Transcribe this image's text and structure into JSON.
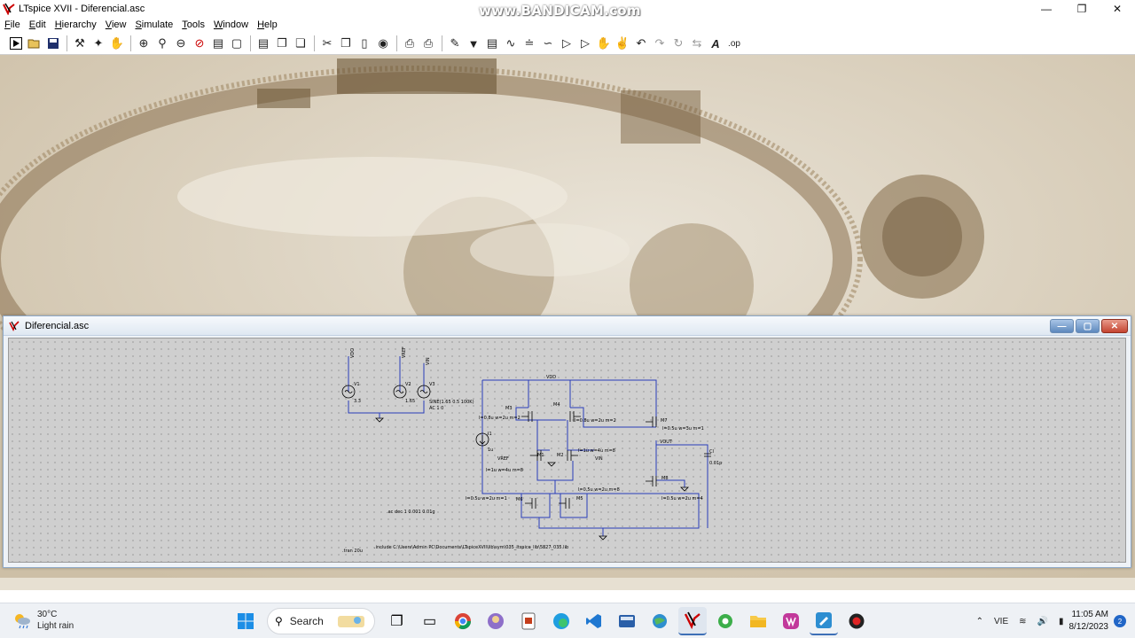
{
  "app": {
    "title": "LTspice XVII - Diferencial.asc",
    "watermark": "www.BANDICAM.com"
  },
  "menu": [
    "File",
    "Edit",
    "Hierarchy",
    "View",
    "Simulate",
    "Tools",
    "Window",
    "Help"
  ],
  "toolbar_icons": [
    "run",
    "open",
    "save",
    "control-panel",
    "halt",
    "pan",
    "zoom-in",
    "zoom-fit",
    "zoom-out",
    "cancel",
    "plot-settings",
    "autorange",
    "tile",
    "cascade",
    "close-all",
    "cut",
    "copy",
    "paste",
    "find",
    "print",
    "print-preview",
    "draw-wire",
    "ground",
    "label-net",
    "resistor",
    "capacitor",
    "inductor",
    "diode",
    "component",
    "move",
    "drag",
    "undo",
    "redo",
    "rotate",
    "mirror",
    "text",
    "spice-directive"
  ],
  "schematic_window": {
    "title": "Diferencial.asc"
  },
  "schematic": {
    "sources": [
      {
        "net": "VDO",
        "name": "V1",
        "value": "3.3"
      },
      {
        "net": "VREF",
        "name": "V2",
        "value": "1.65"
      },
      {
        "net": "VIN",
        "name": "V3",
        "value": "SINE(1.65 0.5 100K)",
        "value2": "AC 1 0"
      }
    ],
    "current_source": {
      "name": "I1",
      "value": "1u"
    },
    "labels": {
      "vdd": "VDD",
      "vout": "VOUT",
      "vref": "VREF",
      "vin": "VIN",
      "cl_name": "Cl",
      "cl_value": "0.01p"
    },
    "mosfets": [
      {
        "name": "M3",
        "params": "l=0.8u w=2u m=2"
      },
      {
        "name": "M4",
        "params": "l=0.8u w=2u m=2"
      },
      {
        "name": "M7",
        "params": "l=0.5u w=3u m=1"
      },
      {
        "name": "M1",
        "params": "l=1u w=4u m=8"
      },
      {
        "name": "M2",
        "params": "l=1u w=4u m=8"
      },
      {
        "name": "M6",
        "params": "l=0.5u w=2u m=1"
      },
      {
        "name": "M5",
        "params": "l=0.5u w=2u m=8"
      },
      {
        "name": "M8",
        "params": "l=0.5u w=2u m=4"
      }
    ],
    "directives": {
      "ac": ".ac dec 1 0.001 0.01g",
      "include": ".include C:\\Users\\Admin PC\\Documents\\LTspiceXVII\\lib\\sym\\035_ltspice_lib\\5827_035.lib",
      "tran": ".tran 20u"
    }
  },
  "taskbar": {
    "weather_temp": "30°C",
    "weather_desc": "Light rain",
    "search_label": "Search",
    "language": "VIE",
    "time": "11:05 AM",
    "date": "8/12/2023",
    "notifications": "2"
  }
}
